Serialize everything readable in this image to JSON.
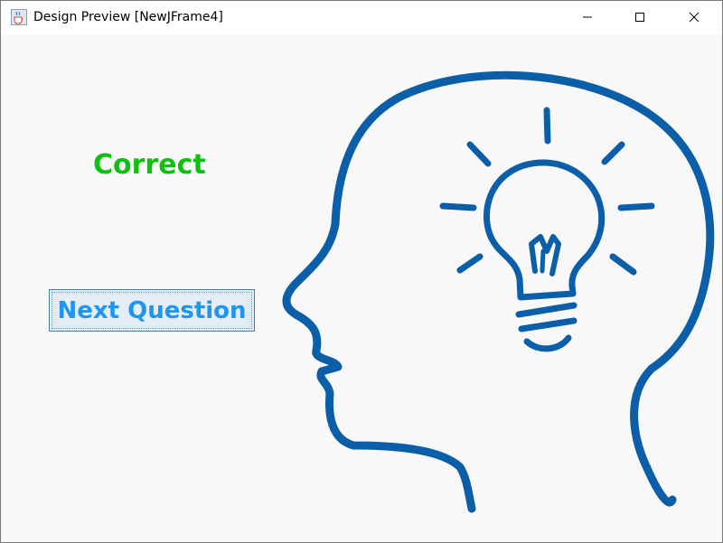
{
  "window": {
    "title": "Design Preview [NewJFrame4]",
    "icon": "java-cup-icon",
    "controls": {
      "minimize_icon": "minimize-icon",
      "maximize_icon": "maximize-icon",
      "close_icon": "close-icon"
    }
  },
  "main": {
    "result_text": "Correct",
    "result_color": "#10c010",
    "next_button_label": "Next Question",
    "next_button_color": "#1e96f0",
    "illustration": "head-with-lightbulb-icon",
    "illustration_color": "#0b5ea8"
  }
}
